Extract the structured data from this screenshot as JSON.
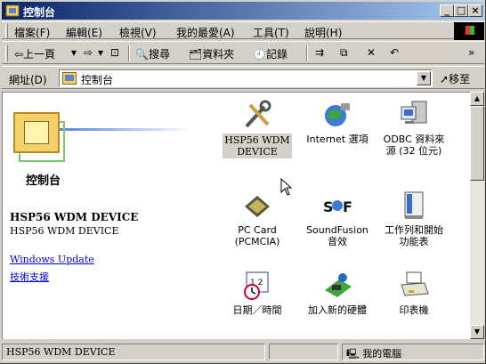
{
  "window": {
    "title": "控制台"
  },
  "menu": [
    "檔案(F)",
    "編輯(E)",
    "檢視(V)",
    "我的最愛(A)",
    "工具(T)",
    "說明(H)"
  ],
  "toolbar": {
    "back": "⇦上一頁",
    "forward": "⇨",
    "up": "⊡",
    "search": "搜尋",
    "folders": "資料夾",
    "history": "記錄",
    "more": "»"
  },
  "address": {
    "label": "網址(D)",
    "value": "控制台",
    "go": "移至"
  },
  "left_panel": {
    "title": "控制台",
    "device_title": "HSP56 WDM DEVICE",
    "device_sub": "HSP56 WDM DEVICE",
    "links": [
      "Windows Update",
      "技術支援"
    ]
  },
  "items": [
    {
      "label": "HSP56 WDM\nDEVICE",
      "icon": "tools-icon",
      "selected": true
    },
    {
      "label": "Internet 選項",
      "icon": "internet-options-icon"
    },
    {
      "label": "ODBC 資料來\n源 (32 位元)",
      "icon": "odbc-icon"
    },
    {
      "label": "PC Card\n(PCMCIA)",
      "icon": "pc-card-icon"
    },
    {
      "label": "SoundFusion\n音效",
      "icon": "soundfusion-icon"
    },
    {
      "label": "工作列和開始\n功能表",
      "icon": "taskbar-icon"
    },
    {
      "label": "日期／時間",
      "icon": "date-time-icon"
    },
    {
      "label": "加入新的硬體",
      "icon": "add-hardware-icon"
    },
    {
      "label": "印表機",
      "icon": "printer-icon"
    }
  ],
  "status": {
    "left": "HSP56 WDM DEVICE",
    "right": "我的電腦"
  }
}
